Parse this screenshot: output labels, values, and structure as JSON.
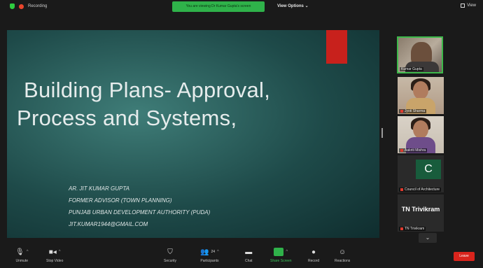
{
  "top": {
    "recording_label": "Recording",
    "share_banner": "You are viewing Dr Kumar Gupta's screen",
    "view_options_label": "View Options ⌄",
    "view_label": "View"
  },
  "slide": {
    "title_line1": "Building Plans- Approval,",
    "title_line2": "Process and  Systems,",
    "author_lines": [
      "AR. JIT KUMAR GUPTA",
      "FORMER  ADVISOR  (TOWN PLANNING)",
      "PUNJAB URBAN DEVELOPMENT AUTHORITY (PUDA)",
      "JIT.KUMAR1944@GMAIL.COM"
    ]
  },
  "participants": [
    {
      "name": "Kumar Gupta"
    },
    {
      "name": "Jyoti Sharma"
    },
    {
      "name": "Aakriti Mishra"
    },
    {
      "name": "Council of Architecture",
      "initial": "C"
    },
    {
      "name": "TN Trivikram",
      "display_name": "TN Trivikram"
    }
  ],
  "toolbar": {
    "unmute": "Unmute",
    "stop_video": "Stop Video",
    "security": "Security",
    "participants": "Participants",
    "participants_count": "24",
    "chat": "Chat",
    "share_screen": "Share Screen",
    "record": "Record",
    "reactions": "Reactions",
    "leave": "Leave"
  },
  "colors": {
    "accent_green": "#2fb24a",
    "leave_red": "#d9241c",
    "slide_red": "#c8211c"
  }
}
